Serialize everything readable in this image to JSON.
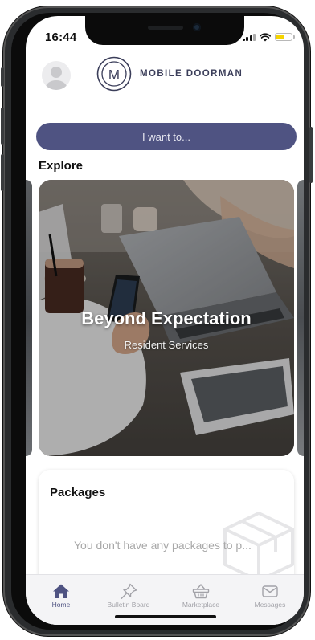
{
  "status_bar": {
    "time": "16:44",
    "signal_icon": "signal-icon",
    "wifi_icon": "wifi-icon",
    "battery_icon": "battery-icon",
    "battery_color": "#f5d400"
  },
  "header": {
    "avatar_icon": "avatar-icon",
    "logo_letter": "M",
    "brand_name": "MOBILE DOORMAN"
  },
  "cta": {
    "label": "I want to...",
    "color": "#4f5382"
  },
  "explore": {
    "heading": "Explore",
    "card": {
      "title": "Beyond Expectation",
      "subtitle": "Resident Services"
    }
  },
  "packages": {
    "title": "Packages",
    "empty_text": "You don't have any packages to p...",
    "icon": "package-box-icon"
  },
  "tabs": [
    {
      "label": "Home",
      "icon": "home-icon",
      "active": true
    },
    {
      "label": "Bulletin Board",
      "icon": "pushpin-icon",
      "active": false
    },
    {
      "label": "Marketplace",
      "icon": "basket-icon",
      "active": false
    },
    {
      "label": "Messages",
      "icon": "envelope-icon",
      "active": false
    }
  ],
  "colors": {
    "brand": "#4f5382",
    "brand_text": "#3b3e5a",
    "tab_inactive": "#a2a2a8"
  }
}
